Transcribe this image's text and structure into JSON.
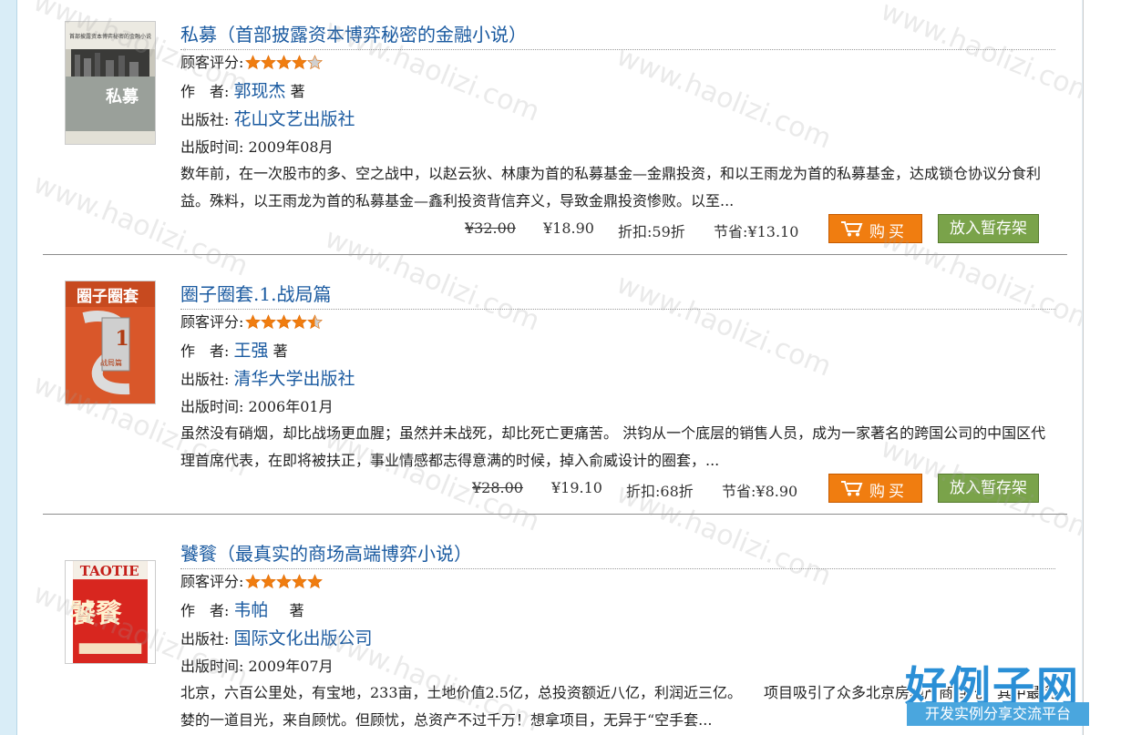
{
  "labels": {
    "rating": "顾客评分:",
    "author": "作　者:",
    "author_suffix": "著",
    "publisher": "出版社:",
    "pubdate": "出版时间:",
    "discount": "折扣:",
    "save": "节省:",
    "buy": "购买",
    "shelf": "放入暂存架"
  },
  "books": [
    {
      "title": "私募（首部披露资本博弈秘密的金融小说）",
      "rating": 4,
      "author": "郭现杰",
      "publisher": "花山文艺出版社",
      "pubdate": "2009年08月",
      "desc": "数年前，在一次股市的多、空之战中，以赵云狄、林康为首的私募基金—金鼎投资，和以王雨龙为首的私募基金，达成锁仓协议分食利益。殊料，以王雨龙为首的私募基金—鑫利投资背信弃义，导致金鼎投资惨败。以至...",
      "orig_price": "¥32.00",
      "price": "¥18.90",
      "discount": "59折",
      "save": "¥13.10",
      "cover_text": "私募",
      "cover_top_text": "首部披露资本博弈秘密的金融小说"
    },
    {
      "title": "圈子圈套.1.战局篇",
      "rating": 4.5,
      "author": "王强",
      "publisher": "清华大学出版社",
      "pubdate": "2006年01月",
      "desc": "虽然没有硝烟，却比战场更血腥；虽然并未战死，却比死亡更痛苦。 洪钧从一个底层的销售人员，成为一家著名的跨国公司的中国区代理首席代表，在即将被扶正，事业情感都志得意满的时候，掉入俞威设计的圈套，...",
      "orig_price": "¥28.00",
      "price": "¥19.10",
      "discount": "68折",
      "save": "¥8.90",
      "cover_text": "圈子圈套",
      "cover_num": "1",
      "cover_sub": "战局篇"
    },
    {
      "title": "饕餮（最真实的商场高端博弈小说）",
      "rating": 5,
      "author": "韦帕",
      "publisher": "国际文化出版公司",
      "pubdate": "2009年07月",
      "desc": "北京，六百公里处，有宝地，233亩，土地价值2.5亿，总投资额近八亿，利润近三亿。　　项目吸引了众多北京房地产商目光，其中最贪婪的一道目光，来自顾忧。但顾忧，总资产不过千万！想拿项目，无异于“空手套...",
      "cover_text": "TAOTIE",
      "cover_big": "饕餮"
    }
  ],
  "watermark": "www.haolizi.com",
  "logo": {
    "main": "好例子网",
    "sub": "开发实例分享交流平台"
  },
  "colors": {
    "link": "#1a5aa0",
    "buy_button": "#f07d10",
    "shelf_button": "#7aa34a",
    "star": "#f07d10"
  }
}
